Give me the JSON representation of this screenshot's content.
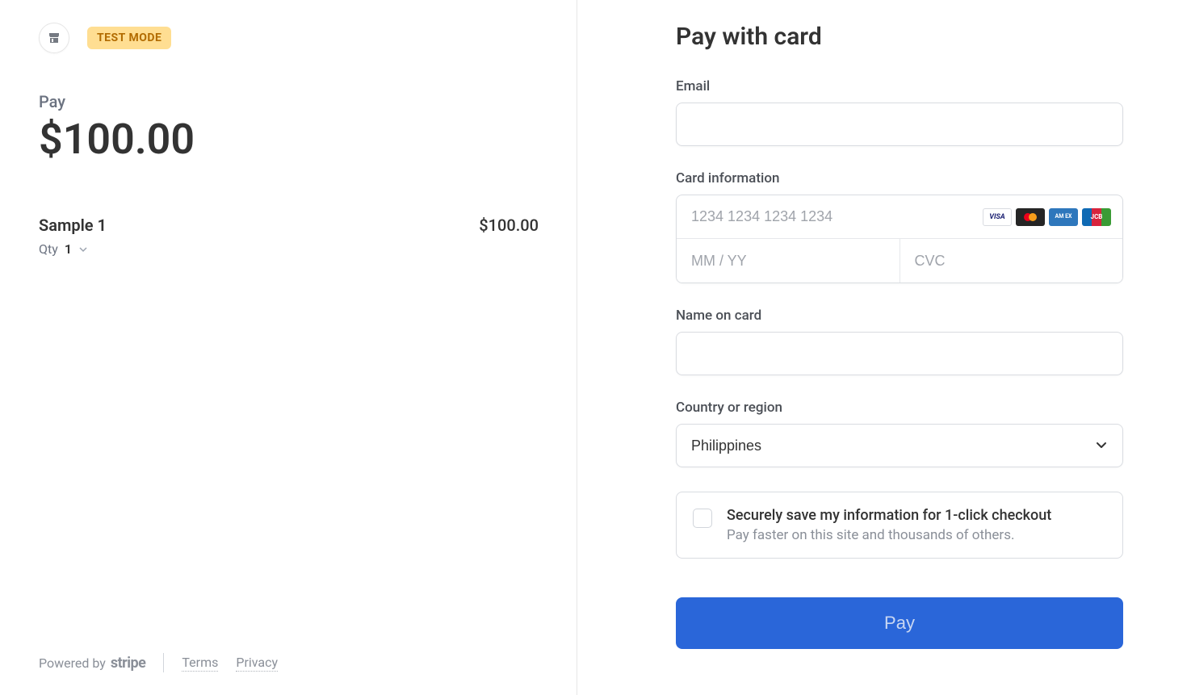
{
  "left": {
    "badge": "TEST MODE",
    "pay_label": "Pay",
    "amount": "$100.00",
    "item": {
      "name": "Sample 1",
      "price": "$100.00"
    },
    "qty_label": "Qty",
    "qty_value": "1",
    "footer": {
      "powered": "Powered by",
      "stripe": "stripe",
      "terms": "Terms",
      "privacy": "Privacy"
    }
  },
  "right": {
    "title": "Pay with card",
    "email_label": "Email",
    "card_label": "Card information",
    "card_number_placeholder": "1234 1234 1234 1234",
    "expiry_placeholder": "MM / YY",
    "cvc_placeholder": "CVC",
    "name_label": "Name on card",
    "country_label": "Country or region",
    "country_value": "Philippines",
    "save_title": "Securely save my information for 1-click checkout",
    "save_sub": "Pay faster on this site and thousands of others.",
    "pay_button": "Pay",
    "brands": {
      "visa": "VISA",
      "amex": "AM EX",
      "jcb": "JCB"
    }
  }
}
